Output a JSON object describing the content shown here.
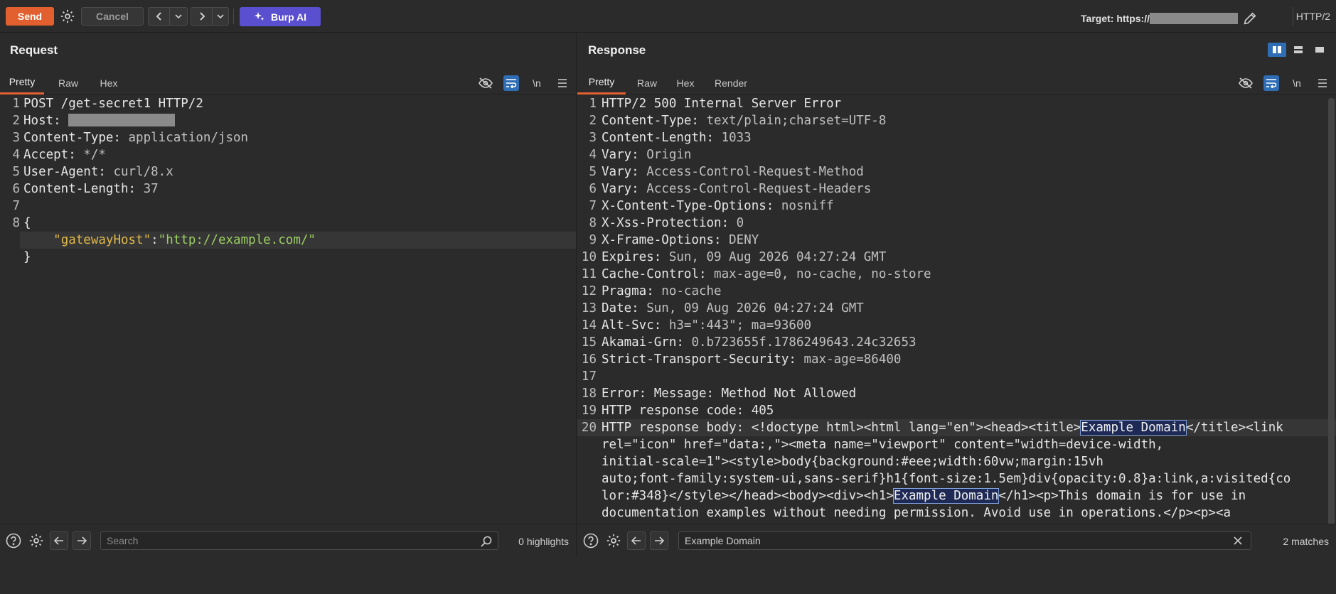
{
  "toolbar": {
    "send_label": "Send",
    "cancel_label": "Cancel",
    "burp_ai_label": "Burp AI",
    "target_label": "Target: https://",
    "protocol": "HTTP/2"
  },
  "request": {
    "title": "Request",
    "tabs": [
      "Pretty",
      "Raw",
      "Hex"
    ],
    "active_tab": "Pretty",
    "tools": {
      "newline": "\\n"
    },
    "search_placeholder": "Search",
    "highlights": "0 highlights"
  },
  "response": {
    "title": "Response",
    "tabs": [
      "Pretty",
      "Raw",
      "Hex",
      "Render"
    ],
    "active_tab": "Pretty",
    "tools": {
      "newline": "\\n"
    },
    "search_value": "Example Domain",
    "matches": "2 matches"
  },
  "colors": {
    "accent": "#e2602f",
    "burp_ai": "#5a4fcf",
    "toggle_on": "#2f6db5"
  }
}
